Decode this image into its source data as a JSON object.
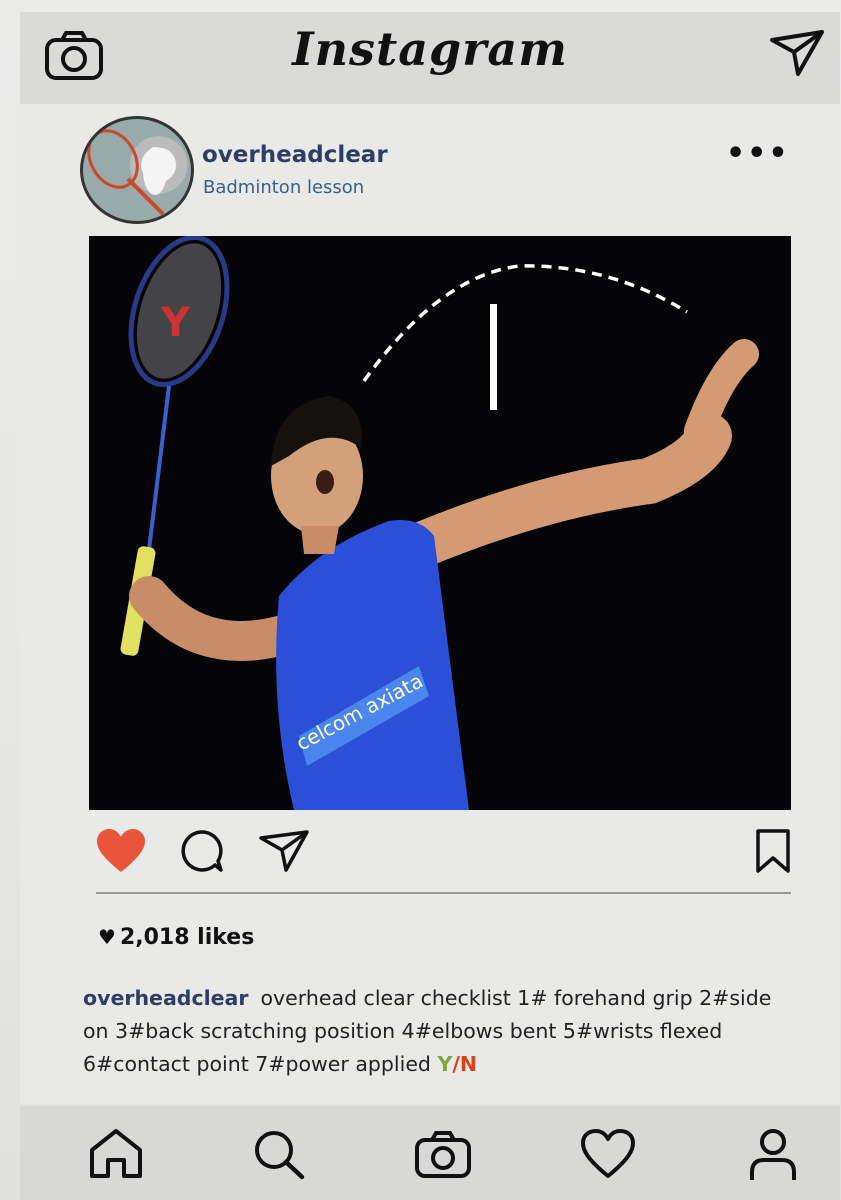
{
  "header": {
    "logo": "Instagram",
    "camera_icon": "camera-icon",
    "direct_icon": "paper-plane-icon"
  },
  "post": {
    "username": "overheadclear",
    "subtitle": "Badminton lesson",
    "more_label": "•••",
    "image_alt": "badminton player hitting overhead clear",
    "liked": true,
    "likes_text": "2,018 likes",
    "caption_user": "overheadclear",
    "caption_text": "overhead clear checklist 1# forehand grip 2#side on 3#back scratching position 4#elbows bent 5#wrists flexed 6#contact point 7#power applied ",
    "caption_y": "Y",
    "caption_slash": "/",
    "caption_n": "N",
    "jersey_text": "celcom axiata"
  },
  "colors": {
    "like_active": "#e8553a",
    "username": "#2c3e66",
    "yes": "#7aa83a",
    "no": "#d9421a"
  },
  "bottom_nav": [
    "home-icon",
    "search-icon",
    "camera-icon",
    "heart-icon",
    "profile-icon"
  ]
}
